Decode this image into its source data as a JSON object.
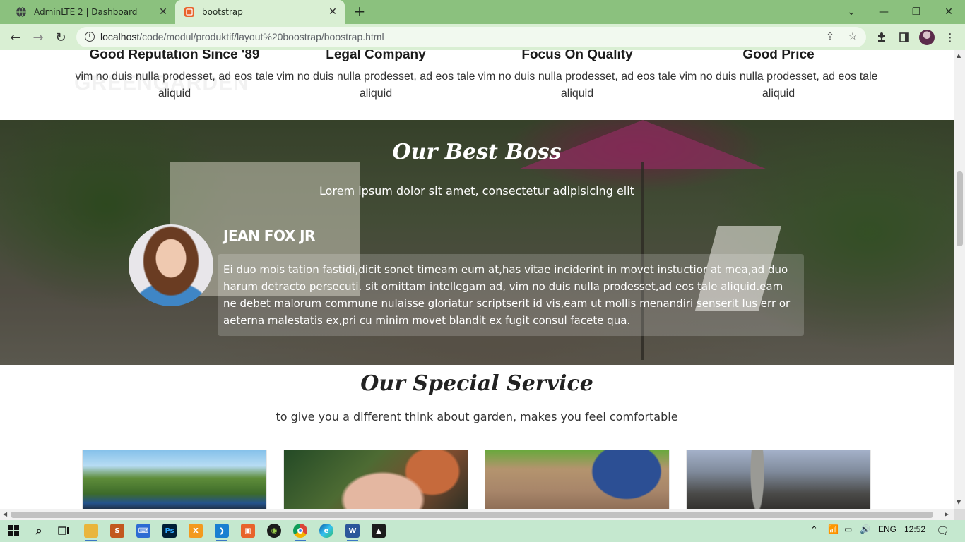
{
  "browser": {
    "tabs": [
      {
        "title": "AdminLTE 2 | Dashboard",
        "icon": "globe-icon",
        "active": false
      },
      {
        "title": "bootstrap",
        "icon": "html-file-icon",
        "active": true
      }
    ],
    "url_host": "localhost",
    "url_path": "/code/modul/produktif/layout%20boostrap/boostrap.html",
    "colors": {
      "tabbar": "#8bc17e",
      "toolbar": "#d9efd3"
    }
  },
  "features": [
    {
      "title": "Good Reputation Since '89",
      "text": "vim no duis nulla prodesset, ad eos tale aliquid"
    },
    {
      "title": "Legal Company",
      "text": "vim no duis nulla prodesset, ad eos tale aliquid"
    },
    {
      "title": "Focus On Quality",
      "text": "vim no duis nulla prodesset, ad eos tale aliquid"
    },
    {
      "title": "Good Price",
      "text": "vim no duis nulla prodesset, ad eos tale aliquid"
    }
  ],
  "boss": {
    "title": "Our Best Boss",
    "subtitle": "Lorem ipsum dolor sit amet, consectetur adipisicing elit",
    "name": "JEAN FOX JR",
    "quote": "Ei duo mois tation fastidi,dicit sonet timeam eum at,has vitae inciderint in movet instuctior at mea,ad duo harum detracto persecuti. sit omittam intellegam ad, vim no duis nulla prodesset,ad eos tale aliquid.eam ne debet malorum commune nulaisse gloriatur scriptserit id vis,eam ut mollis menandiri senserit lus err or aeterna malestatis ex,pri cu minim movet blandit ex fugit consul facete qua."
  },
  "service": {
    "title": "Our Special Service",
    "subtitle": "to give you a different think about garden, makes you feel comfortable",
    "cards": [
      "lawn-mower-photo",
      "potted-plant-photo",
      "planting-hands-photo",
      "garden-shovel-photo"
    ]
  },
  "taskbar": {
    "language": "ENG",
    "time": "12:52"
  }
}
